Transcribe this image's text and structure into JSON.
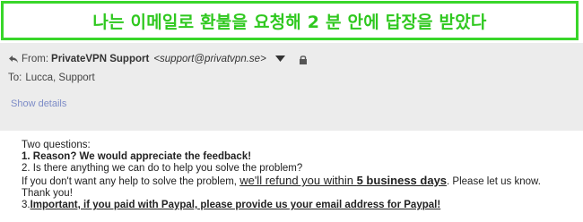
{
  "banner": {
    "text": "나는 이메일로 환불을 요청해  2 분 안에 답장을 받았다"
  },
  "email": {
    "from_label": "From:",
    "sender_name": "PrivateVPN Support",
    "sender_email": "<support@privatvpn.se>",
    "to_label": "To:",
    "recipients": "Lucca, Support",
    "show_details": "Show details",
    "body": {
      "line1": "Two questions:",
      "line2": "1. Reason? We would appreciate the feedback!",
      "line3": "2. Is there anything we can do to help you solve the problem?",
      "line4_a": "If you don't want any help to solve the problem, ",
      "line4_b": "we'll refund you within ",
      "line4_c": "5 business days",
      "line4_d": ". Please let us know.",
      "line5": "Thank you!",
      "line6_a": "3.",
      "line6_b": "Important, if you paid with Paypal, please provide us your email address for Paypal!"
    }
  }
}
